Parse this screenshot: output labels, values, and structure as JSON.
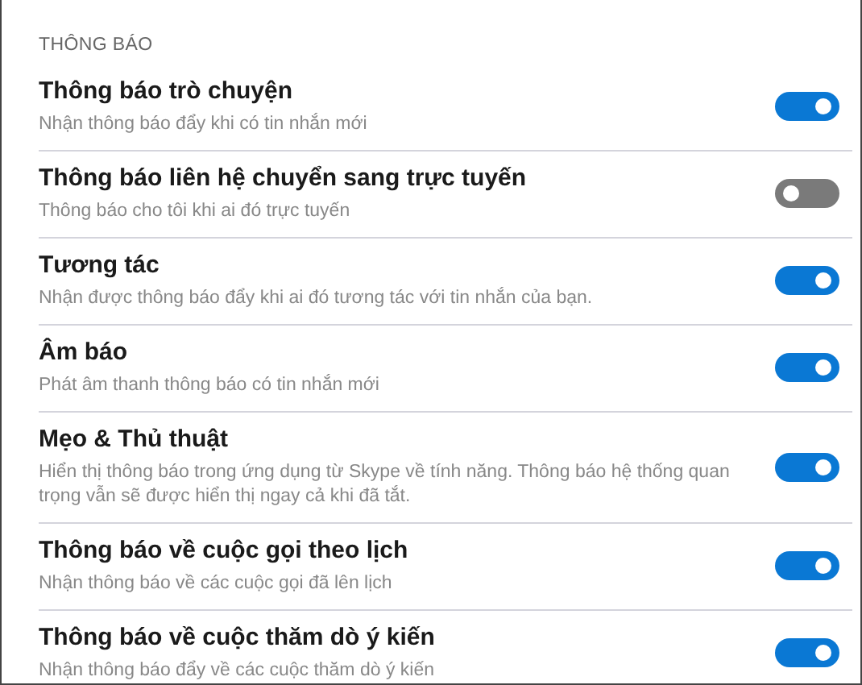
{
  "section_title": "THÔNG BÁO",
  "settings": [
    {
      "title": "Thông báo trò chuyện",
      "description": "Nhận thông báo đẩy khi có tin nhắn mới",
      "on": true
    },
    {
      "title": "Thông báo liên hệ chuyển sang trực tuyến",
      "description": "Thông báo cho tôi khi ai đó trực tuyến",
      "on": false
    },
    {
      "title": "Tương tác",
      "description": "Nhận được thông báo đẩy khi ai đó tương tác với tin nhắn của bạn.",
      "on": true
    },
    {
      "title": "Âm báo",
      "description": "Phát âm thanh thông báo có tin nhắn mới",
      "on": true
    },
    {
      "title": "Mẹo & Thủ thuật",
      "description": "Hiển thị thông báo trong ứng dụng từ Skype về tính năng. Thông báo hệ thống quan trọng vẫn sẽ được hiển thị ngay cả khi đã tắt.",
      "on": true
    },
    {
      "title": "Thông báo về cuộc gọi theo lịch",
      "description": "Nhận thông báo về các cuộc gọi đã lên lịch",
      "on": true
    },
    {
      "title": "Thông báo về cuộc thăm dò ý kiến",
      "description": "Nhận thông báo đẩy về các cuộc thăm dò ý kiến",
      "on": true
    }
  ]
}
